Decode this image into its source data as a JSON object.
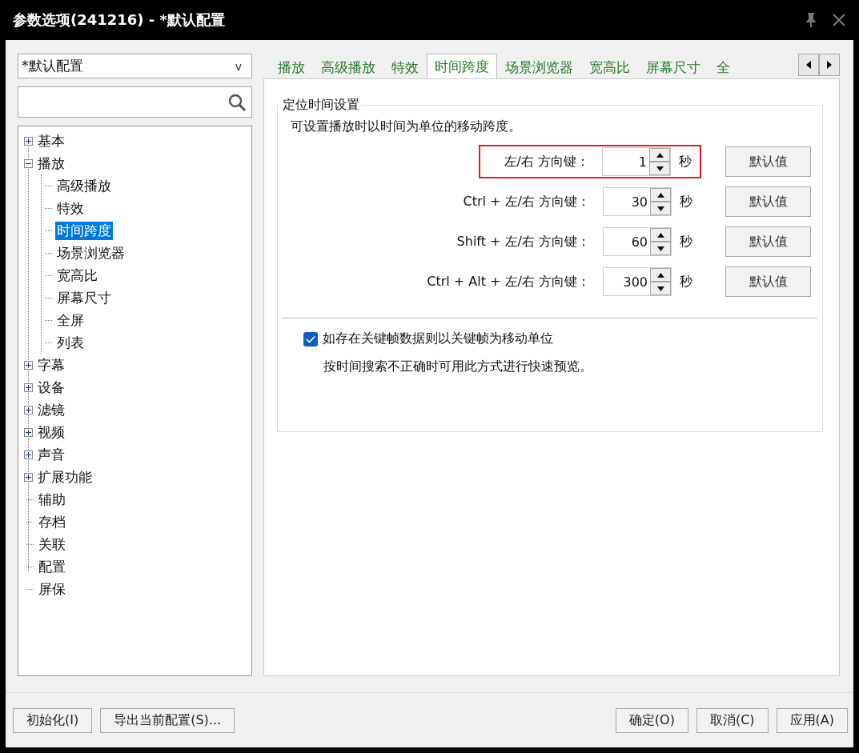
{
  "window": {
    "title": "参数选项(241216) - *默认配置"
  },
  "profile_select": {
    "value": "*默认配置",
    "caret": "v"
  },
  "tree": [
    {
      "label": "基本",
      "expanded": false,
      "selected": false
    },
    {
      "label": "播放",
      "expanded": true,
      "selected": false,
      "children": [
        {
          "label": "高级播放",
          "selected": false
        },
        {
          "label": "特效",
          "selected": false
        },
        {
          "label": "时间跨度",
          "selected": true
        },
        {
          "label": "场景浏览器",
          "selected": false
        },
        {
          "label": "宽高比",
          "selected": false
        },
        {
          "label": "屏幕尺寸",
          "selected": false
        },
        {
          "label": "全屏",
          "selected": false
        },
        {
          "label": "列表",
          "selected": false
        }
      ]
    },
    {
      "label": "字幕",
      "expanded": false,
      "selected": false
    },
    {
      "label": "设备",
      "expanded": false,
      "selected": false
    },
    {
      "label": "滤镜",
      "expanded": false,
      "selected": false
    },
    {
      "label": "视频",
      "expanded": false,
      "selected": false
    },
    {
      "label": "声音",
      "expanded": false,
      "selected": false
    },
    {
      "label": "扩展功能",
      "expanded": false,
      "selected": false
    },
    {
      "label": "辅助",
      "selected": false
    },
    {
      "label": "存档",
      "selected": false
    },
    {
      "label": "关联",
      "selected": false
    },
    {
      "label": "配置",
      "selected": false
    },
    {
      "label": "屏保",
      "selected": false
    }
  ],
  "tabs": [
    {
      "label": "播放",
      "selected": false
    },
    {
      "label": "高级播放",
      "selected": false
    },
    {
      "label": "特效",
      "selected": false
    },
    {
      "label": "时间跨度",
      "selected": true
    },
    {
      "label": "场景浏览器",
      "selected": false
    },
    {
      "label": "宽高比",
      "selected": false
    },
    {
      "label": "屏幕尺寸",
      "selected": false
    },
    {
      "label": "全",
      "selected": false
    }
  ],
  "group": {
    "title": "定位时间设置",
    "description": "可设置播放时以时间为单位的移动跨度。",
    "rows": [
      {
        "label": "左/右 方向键：",
        "value": "1",
        "unit": "秒",
        "button": "默认值",
        "highlighted": true
      },
      {
        "label": "Ctrl + 左/右 方向键：",
        "value": "30",
        "unit": "秒",
        "button": "默认值",
        "highlighted": false
      },
      {
        "label": "Shift + 左/右 方向键：",
        "value": "60",
        "unit": "秒",
        "button": "默认值",
        "highlighted": false
      },
      {
        "label": "Ctrl + Alt + 左/右 方向键：",
        "value": "300",
        "unit": "秒",
        "button": "默认值",
        "highlighted": false
      }
    ],
    "checkbox": {
      "label": "如存在关键帧数据则以关键帧为移动单位",
      "checked": true,
      "hint": "按时间搜索不正确时可用此方式进行快速预览。"
    }
  },
  "footer": {
    "left_buttons": [
      "初始化(I)",
      "导出当前配置(S)..."
    ],
    "right_buttons": [
      "确定(O)",
      "取消(C)",
      "应用(A)"
    ]
  }
}
